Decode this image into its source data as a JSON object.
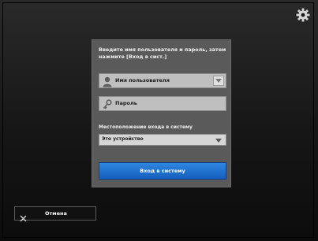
{
  "dialog": {
    "instruction": "Введите имя пользователя и пароль, затем нажмите [Вход в сист.]",
    "username_placeholder": "Имя пользователя",
    "password_placeholder": "Пароль",
    "destination_label": "Местоположение входа в систему",
    "destination_value": "Это устройство",
    "signin_label": "Вход в систему"
  },
  "footer": {
    "cancel_label": "Отмена"
  },
  "colors": {
    "accent": "#1f6fd0",
    "dialog_bg": "#5a5a5a",
    "field_bg": "#bfbfbf"
  },
  "icons": [
    "gear-icon",
    "user-icon",
    "key-icon",
    "chevron-down-icon",
    "close-icon"
  ]
}
